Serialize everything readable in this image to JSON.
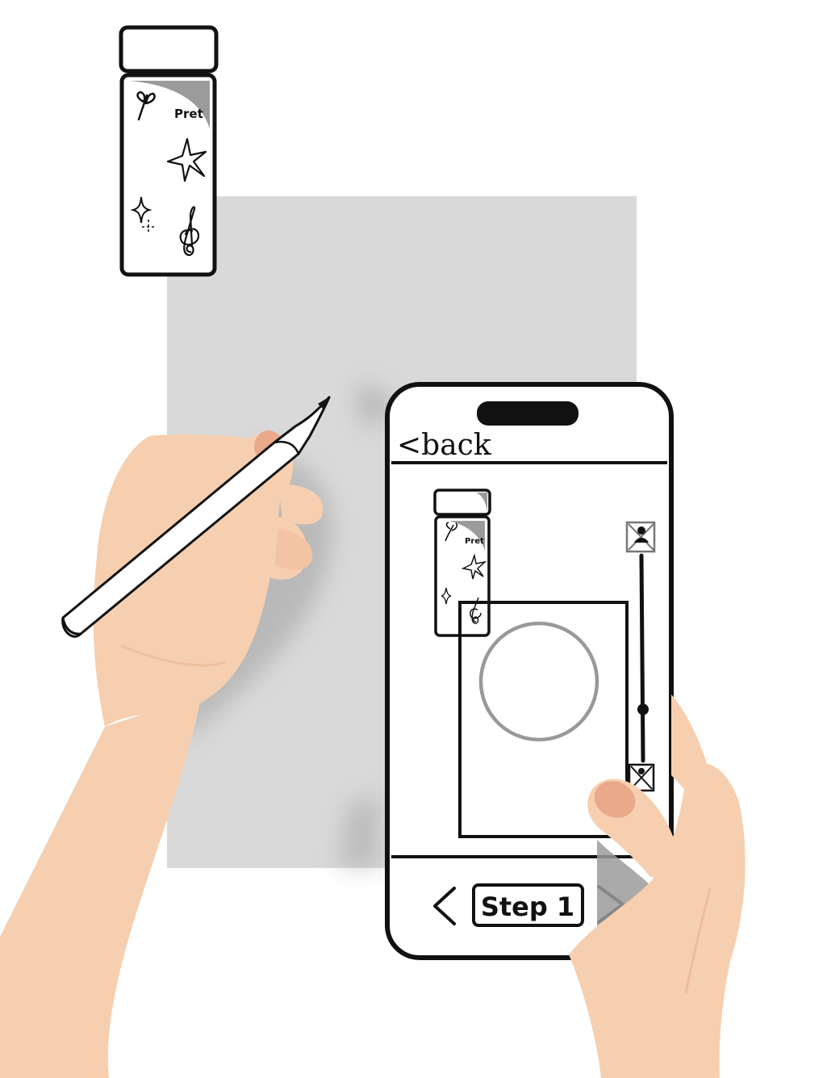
{
  "illustration": {
    "paper_color": "#d9d9d9",
    "skin_color": "#f6cfb0",
    "skin_shadow": "#e9b592",
    "ink_color": "#111111",
    "accent_gray": "#999999"
  },
  "sticker_sheet": {
    "brand_text": "Pret",
    "icons": [
      "sprout-icon",
      "star-icon",
      "sparkle-icon",
      "treble-clef-icon"
    ]
  },
  "phone": {
    "back_label": "<back",
    "step_label": "Step 1",
    "prev_icon": "chevron-left-icon",
    "next_icon": "chevron-right-icon",
    "opacity_slider_value": 0.75,
    "preview_sheet_text": "Pret"
  }
}
